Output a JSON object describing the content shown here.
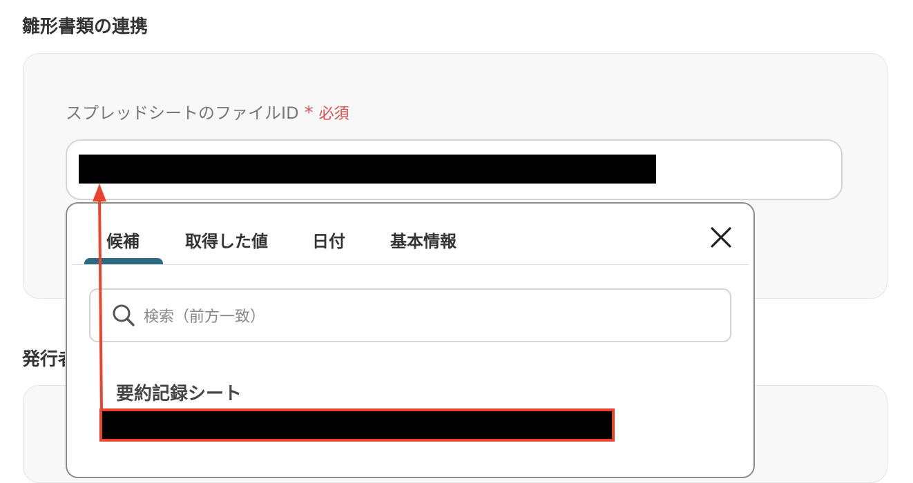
{
  "sections": [
    {
      "title": "雛形書類の連携"
    },
    {
      "title": "発行者"
    }
  ],
  "field": {
    "label": "スプレッドシートのファイルID",
    "required_star": "*",
    "required_text": "必須"
  },
  "dropdown": {
    "tabs": [
      "候補",
      "取得した値",
      "日付",
      "基本情報"
    ],
    "active_tab": "候補",
    "search_placeholder": "検索（前方一致）",
    "group_label": "要約記録シート"
  },
  "colors": {
    "accent": "#2e6b80",
    "required": "#e04e4e",
    "annotation": "#e8452c"
  }
}
